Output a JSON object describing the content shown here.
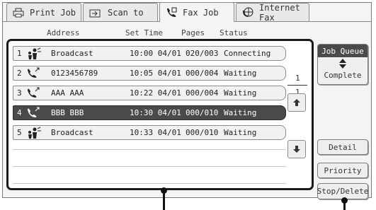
{
  "tabs": [
    {
      "label": "Print Job",
      "icon": "printer-icon",
      "active": false
    },
    {
      "label": "Scan to",
      "icon": "scanner-icon",
      "active": false
    },
    {
      "label": "Fax Job",
      "icon": "fax-phone-icon",
      "active": true
    },
    {
      "label": "Internet Fax",
      "icon": "globe-fax-icon",
      "active": false
    }
  ],
  "columns": {
    "address": "Address",
    "set_time": "Set Time",
    "pages": "Pages",
    "status": "Status"
  },
  "jobs": [
    {
      "num": "1",
      "icon": "broadcast-icon",
      "address": "Broadcast",
      "time": "10:00 04/01",
      "pages": "020/003",
      "status": "Connecting",
      "selected": false
    },
    {
      "num": "2",
      "icon": "fax-send-icon",
      "address": "0123456789",
      "time": "10:05 04/01",
      "pages": "000/004",
      "status": "Waiting",
      "selected": false
    },
    {
      "num": "3",
      "icon": "fax-send-icon",
      "address": "AAA AAA",
      "time": "10:22 04/01",
      "pages": "000/004",
      "status": "Waiting",
      "selected": false
    },
    {
      "num": "4",
      "icon": "fax-send-icon",
      "address": "BBB BBB",
      "time": "10:30 04/01",
      "pages": "000/010",
      "status": "Waiting",
      "selected": true
    },
    {
      "num": "5",
      "icon": "broadcast-icon",
      "address": "Broadcast",
      "time": "10:33 04/01",
      "pages": "000/010",
      "status": "Waiting",
      "selected": false
    }
  ],
  "pager": {
    "current": "1",
    "total": "1"
  },
  "buttons": {
    "job_queue": "Job Queue",
    "complete": "Complete",
    "detail": "Detail",
    "priority": "Priority",
    "stop_delete": "Stop/Delete"
  }
}
